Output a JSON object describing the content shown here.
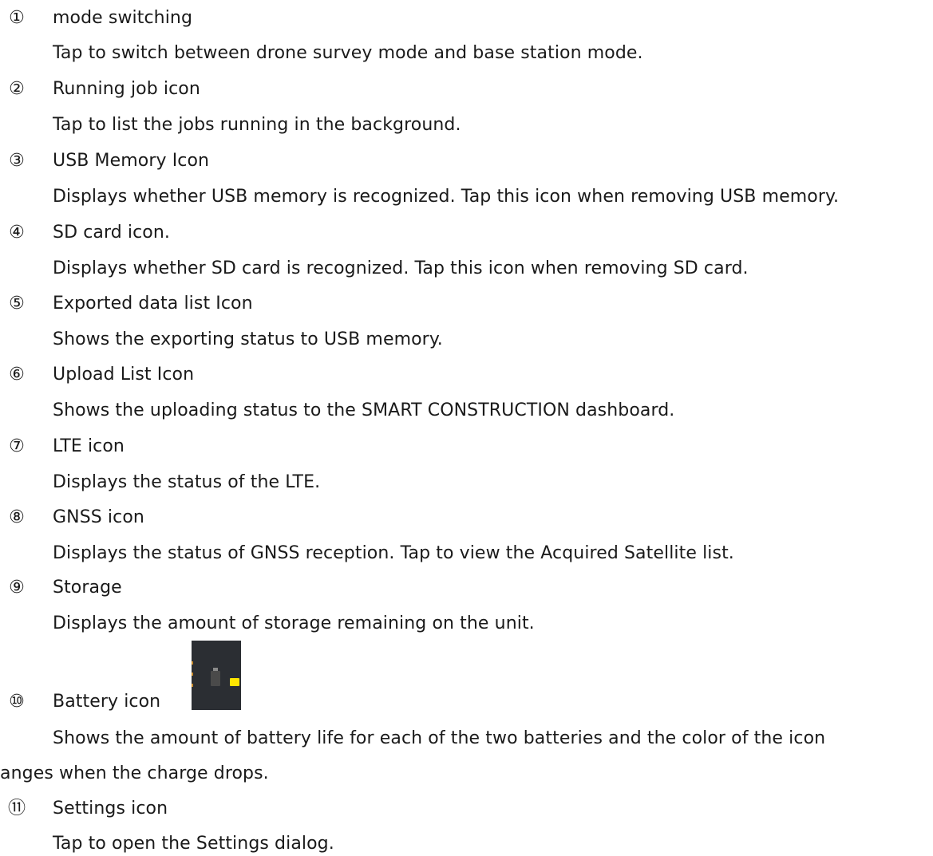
{
  "items": [
    {
      "num": "①",
      "title": "mode switching",
      "desc": "Tap to switch between drone survey mode and base station mode."
    },
    {
      "num": "②",
      "title": "Running job icon",
      "desc": "Tap to list the jobs running in the background."
    },
    {
      "num": "③",
      "title": "USB Memory Icon",
      "desc": "Displays whether USB memory is recognized. Tap this icon when removing USB memory."
    },
    {
      "num": "④",
      "title": "SD card icon.",
      "desc": "Displays whether SD card is recognized. Tap this icon when removing SD card."
    },
    {
      "num": "⑤",
      "title": "Exported data list Icon",
      "desc": "Shows the exporting status to USB memory."
    },
    {
      "num": "⑥",
      "title": "Upload List Icon",
      "desc": "Shows the uploading status to the SMART CONSTRUCTION dashboard."
    },
    {
      "num": "⑦",
      "title": "LTE icon",
      "desc": "Displays the status of the LTE."
    },
    {
      "num": "⑧",
      "title": "GNSS icon",
      "desc": "Displays the status of GNSS reception. Tap to view the Acquired Satellite list."
    },
    {
      "num": "⑨",
      "title": "Storage",
      "desc": "Displays the amount of storage remaining on the unit."
    },
    {
      "num": "⑩",
      "title": "Battery icon",
      "desc": "Shows the amount of battery life for each of the two batteries and the color of the icon",
      "desc2": "anges when the charge drops."
    },
    {
      "num": "⑪",
      "title": "Settings icon",
      "desc": "Tap to open the Settings dialog."
    }
  ],
  "battery_thumbnail": {
    "icon": "battery-icon",
    "fill_color": "#ffe600",
    "background_color": "#2b2e33",
    "charge_level": 0.55
  }
}
